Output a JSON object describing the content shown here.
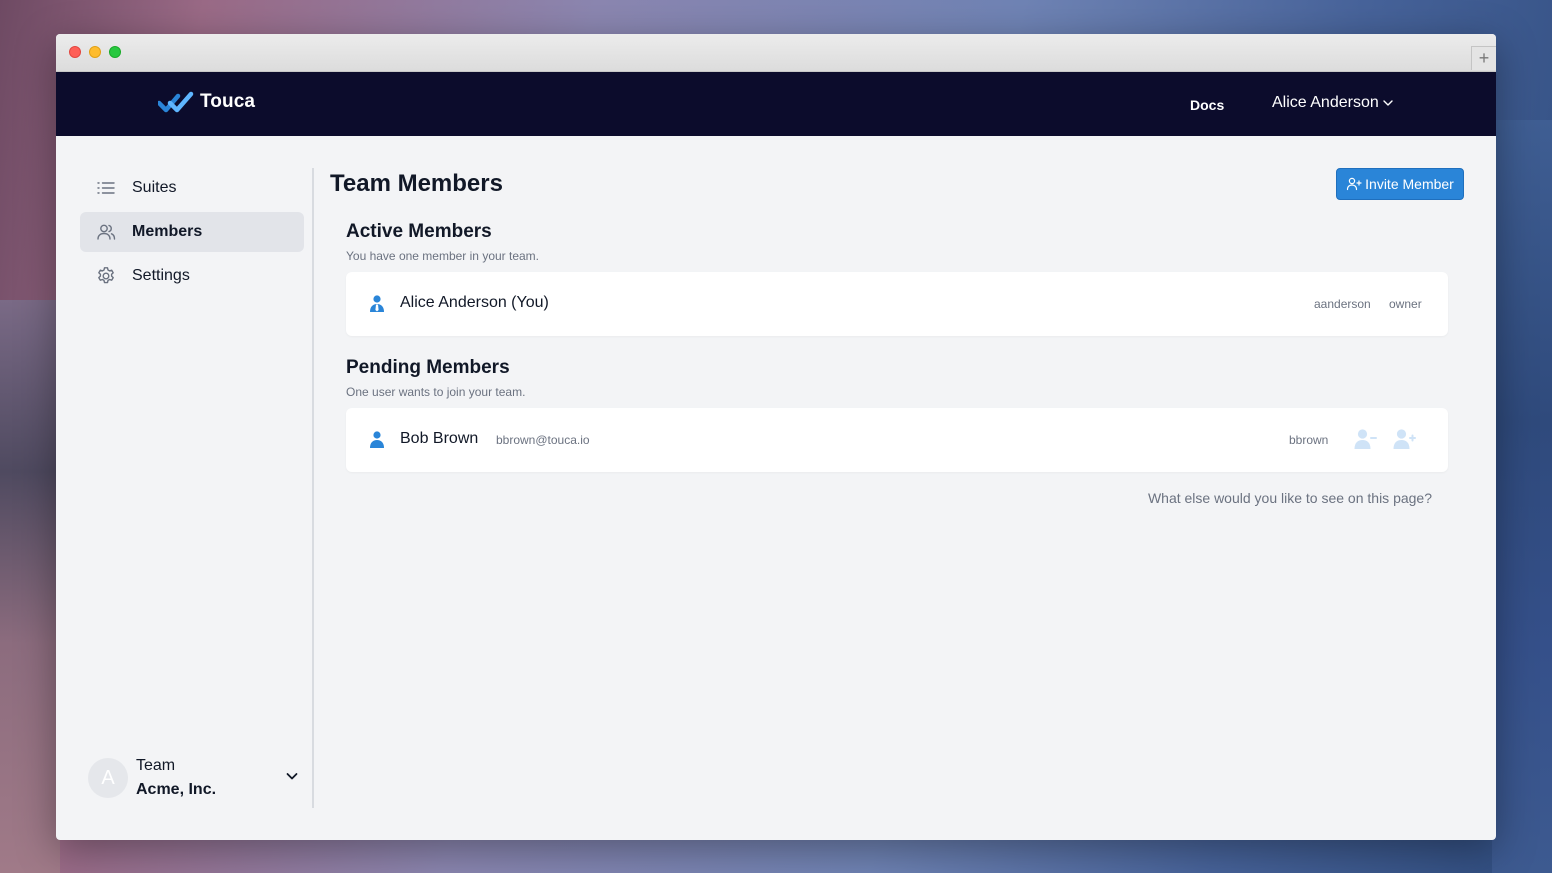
{
  "colors": {
    "navbar": "#0c0c2c",
    "accent": "#2a85d8",
    "muted_text": "#6b7280",
    "page_bg": "#f3f4f6"
  },
  "navbar": {
    "brand": "Touca",
    "brand_icon": "touca-logo-icon",
    "docs": "Docs",
    "user": "Alice Anderson",
    "user_icon": "chevron-down-icon"
  },
  "sidebar": {
    "items": [
      {
        "label": "Suites",
        "icon": "list-icon"
      },
      {
        "label": "Members",
        "icon": "users-icon",
        "active": true
      },
      {
        "label": "Settings",
        "icon": "gear-icon"
      }
    ],
    "team": {
      "avatar_letter": "A",
      "label": "Team",
      "name": "Acme, Inc."
    }
  },
  "main": {
    "title": "Team Members",
    "invite_button": "Invite Member",
    "active": {
      "title": "Active Members",
      "subtitle": "You have one member in your team.",
      "members": [
        {
          "name": "Alice Anderson (You)",
          "username": "aanderson",
          "role": "owner"
        }
      ]
    },
    "pending": {
      "title": "Pending Members",
      "subtitle": "One user wants to join your team.",
      "members": [
        {
          "name": "Bob Brown",
          "email": "bbrown@touca.io",
          "username": "bbrown"
        }
      ]
    },
    "feedback": "What else would you like to see on this page?"
  }
}
